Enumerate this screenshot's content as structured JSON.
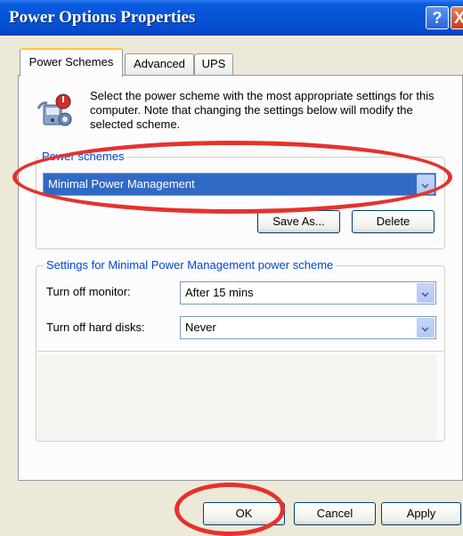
{
  "window": {
    "title": "Power Options Properties",
    "help_symbol": "?",
    "close_symbol": "X"
  },
  "tabs": [
    {
      "label": "Power Schemes",
      "active": true
    },
    {
      "label": "Advanced",
      "active": false
    },
    {
      "label": "UPS",
      "active": false
    }
  ],
  "description": "Select the power scheme with the most appropriate settings for this computer. Note that changing the settings below will modify the selected scheme.",
  "power_schemes": {
    "group_label": "Power schemes",
    "selected": "Minimal Power Management",
    "save_as_label": "Save As...",
    "delete_label": "Delete"
  },
  "settings": {
    "group_label": "Settings for Minimal Power Management power scheme",
    "monitor_label": "Turn off monitor:",
    "monitor_value": "After 15 mins",
    "disks_label": "Turn off hard disks:",
    "disks_value": "Never"
  },
  "buttons": {
    "ok": "OK",
    "cancel": "Cancel",
    "apply": "Apply"
  },
  "colors": {
    "titlebar": "#0553d6",
    "annotation": "#e5322d",
    "selection": "#316ac5"
  },
  "icons": [
    "help-icon",
    "close-icon",
    "power-scheme-icon",
    "dropdown-arrow-icon"
  ]
}
